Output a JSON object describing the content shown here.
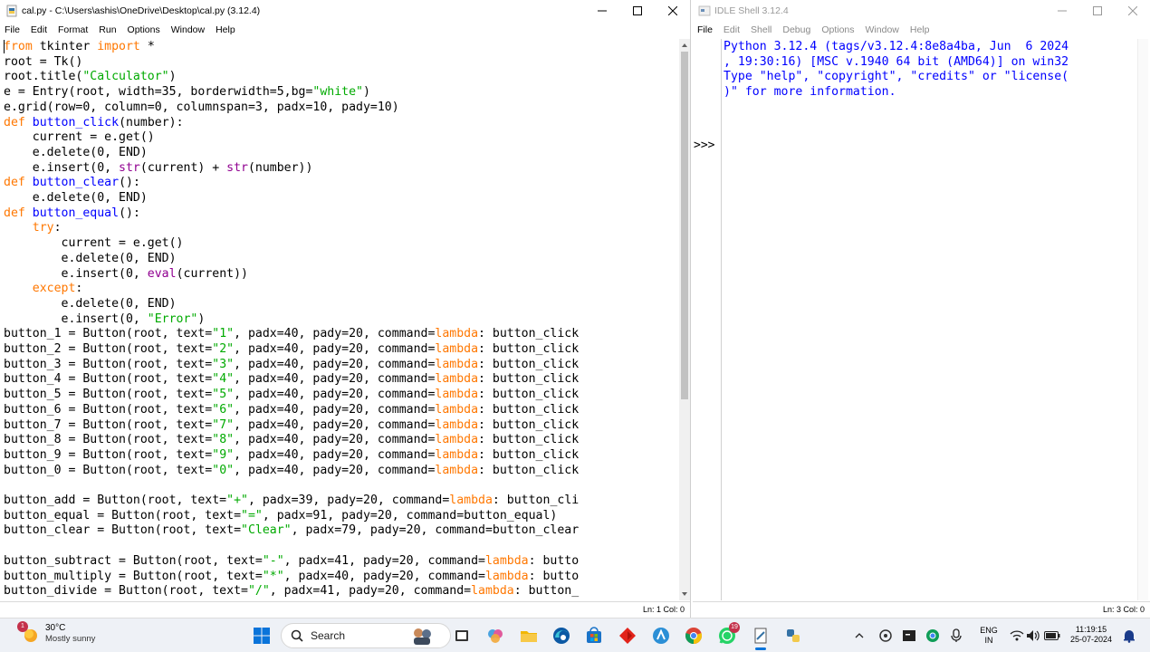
{
  "editor": {
    "title": "cal.py - C:\\Users\\ashis\\OneDrive\\Desktop\\cal.py (3.12.4)",
    "menu": [
      "File",
      "Edit",
      "Format",
      "Run",
      "Options",
      "Window",
      "Help"
    ],
    "status": "Ln: 1   Col: 0",
    "lines": [
      {
        "y": 0,
        "parts": [
          {
            "t": "from",
            "c": "kw"
          },
          {
            "t": " tkinter "
          },
          {
            "t": "import",
            "c": "kw"
          },
          {
            "t": " *"
          }
        ]
      },
      {
        "y": 1,
        "parts": [
          {
            "t": "root = Tk()"
          }
        ]
      },
      {
        "y": 2,
        "parts": [
          {
            "t": "root.title("
          },
          {
            "t": "\"Calculator\"",
            "c": "str"
          },
          {
            "t": ")"
          }
        ]
      },
      {
        "y": 3,
        "parts": [
          {
            "t": "e = Entry(root, width=35, borderwidth=5,bg="
          },
          {
            "t": "\"white\"",
            "c": "str"
          },
          {
            "t": ")"
          }
        ]
      },
      {
        "y": 4,
        "parts": [
          {
            "t": "e.grid(row=0, column=0, columnspan=3, padx=10, pady=10)"
          }
        ]
      },
      {
        "y": 5,
        "parts": [
          {
            "t": "def",
            "c": "kw"
          },
          {
            "t": " "
          },
          {
            "t": "button_click",
            "c": "def"
          },
          {
            "t": "(number):"
          }
        ]
      },
      {
        "y": 6,
        "parts": [
          {
            "t": "    current = e.get()"
          }
        ]
      },
      {
        "y": 7,
        "parts": [
          {
            "t": "    e.delete(0, END)"
          }
        ]
      },
      {
        "y": 8,
        "parts": [
          {
            "t": "    e.insert(0, "
          },
          {
            "t": "str",
            "c": "bi"
          },
          {
            "t": "(current) + "
          },
          {
            "t": "str",
            "c": "bi"
          },
          {
            "t": "(number))"
          }
        ]
      },
      {
        "y": 9,
        "parts": [
          {
            "t": "def",
            "c": "kw"
          },
          {
            "t": " "
          },
          {
            "t": "button_clear",
            "c": "def"
          },
          {
            "t": "():"
          }
        ]
      },
      {
        "y": 10,
        "parts": [
          {
            "t": "    e.delete(0, END)"
          }
        ]
      },
      {
        "y": 11,
        "parts": [
          {
            "t": "def",
            "c": "kw"
          },
          {
            "t": " "
          },
          {
            "t": "button_equal",
            "c": "def"
          },
          {
            "t": "():"
          }
        ]
      },
      {
        "y": 12,
        "parts": [
          {
            "t": "    "
          },
          {
            "t": "try",
            "c": "kw"
          },
          {
            "t": ":"
          }
        ]
      },
      {
        "y": 13,
        "parts": [
          {
            "t": "        current = e.get()"
          }
        ]
      },
      {
        "y": 14,
        "parts": [
          {
            "t": "        e.delete(0, END)"
          }
        ]
      },
      {
        "y": 15,
        "parts": [
          {
            "t": "        e.insert(0, "
          },
          {
            "t": "eval",
            "c": "bi"
          },
          {
            "t": "(current))"
          }
        ]
      },
      {
        "y": 16,
        "parts": [
          {
            "t": "    "
          },
          {
            "t": "except",
            "c": "kw"
          },
          {
            "t": ":"
          }
        ]
      },
      {
        "y": 17,
        "parts": [
          {
            "t": "        e.delete(0, END)"
          }
        ]
      },
      {
        "y": 18,
        "parts": [
          {
            "t": "        e.insert(0, "
          },
          {
            "t": "\"Error\"",
            "c": "str"
          },
          {
            "t": ")"
          }
        ]
      },
      {
        "y": 19,
        "parts": [
          {
            "t": "button_1 = Button(root, text="
          },
          {
            "t": "\"1\"",
            "c": "str"
          },
          {
            "t": ", padx=40, pady=20, command="
          },
          {
            "t": "lambda",
            "c": "kw"
          },
          {
            "t": ": button_click"
          }
        ]
      },
      {
        "y": 20,
        "parts": [
          {
            "t": "button_2 = Button(root, text="
          },
          {
            "t": "\"2\"",
            "c": "str"
          },
          {
            "t": ", padx=40, pady=20, command="
          },
          {
            "t": "lambda",
            "c": "kw"
          },
          {
            "t": ": button_click"
          }
        ]
      },
      {
        "y": 21,
        "parts": [
          {
            "t": "button_3 = Button(root, text="
          },
          {
            "t": "\"3\"",
            "c": "str"
          },
          {
            "t": ", padx=40, pady=20, command="
          },
          {
            "t": "lambda",
            "c": "kw"
          },
          {
            "t": ": button_click"
          }
        ]
      },
      {
        "y": 22,
        "parts": [
          {
            "t": "button_4 = Button(root, text="
          },
          {
            "t": "\"4\"",
            "c": "str"
          },
          {
            "t": ", padx=40, pady=20, command="
          },
          {
            "t": "lambda",
            "c": "kw"
          },
          {
            "t": ": button_click"
          }
        ]
      },
      {
        "y": 23,
        "parts": [
          {
            "t": "button_5 = Button(root, text="
          },
          {
            "t": "\"5\"",
            "c": "str"
          },
          {
            "t": ", padx=40, pady=20, command="
          },
          {
            "t": "lambda",
            "c": "kw"
          },
          {
            "t": ": button_click"
          }
        ]
      },
      {
        "y": 24,
        "parts": [
          {
            "t": "button_6 = Button(root, text="
          },
          {
            "t": "\"6\"",
            "c": "str"
          },
          {
            "t": ", padx=40, pady=20, command="
          },
          {
            "t": "lambda",
            "c": "kw"
          },
          {
            "t": ": button_click"
          }
        ]
      },
      {
        "y": 25,
        "parts": [
          {
            "t": "button_7 = Button(root, text="
          },
          {
            "t": "\"7\"",
            "c": "str"
          },
          {
            "t": ", padx=40, pady=20, command="
          },
          {
            "t": "lambda",
            "c": "kw"
          },
          {
            "t": ": button_click"
          }
        ]
      },
      {
        "y": 26,
        "parts": [
          {
            "t": "button_8 = Button(root, text="
          },
          {
            "t": "\"8\"",
            "c": "str"
          },
          {
            "t": ", padx=40, pady=20, command="
          },
          {
            "t": "lambda",
            "c": "kw"
          },
          {
            "t": ": button_click"
          }
        ]
      },
      {
        "y": 27,
        "parts": [
          {
            "t": "button_9 = Button(root, text="
          },
          {
            "t": "\"9\"",
            "c": "str"
          },
          {
            "t": ", padx=40, pady=20, command="
          },
          {
            "t": "lambda",
            "c": "kw"
          },
          {
            "t": ": button_click"
          }
        ]
      },
      {
        "y": 28,
        "parts": [
          {
            "t": "button_0 = Button(root, text="
          },
          {
            "t": "\"0\"",
            "c": "str"
          },
          {
            "t": ", padx=40, pady=20, command="
          },
          {
            "t": "lambda",
            "c": "kw"
          },
          {
            "t": ": button_click"
          }
        ]
      },
      {
        "y": 30,
        "parts": [
          {
            "t": "button_add = Button(root, text="
          },
          {
            "t": "\"+\"",
            "c": "str"
          },
          {
            "t": ", padx=39, pady=20, command="
          },
          {
            "t": "lambda",
            "c": "kw"
          },
          {
            "t": ": button_cli"
          }
        ]
      },
      {
        "y": 31,
        "parts": [
          {
            "t": "button_equal = Button(root, text="
          },
          {
            "t": "\"=\"",
            "c": "str"
          },
          {
            "t": ", padx=91, pady=20, command=button_equal)"
          }
        ]
      },
      {
        "y": 32,
        "parts": [
          {
            "t": "button_clear = Button(root, text="
          },
          {
            "t": "\"Clear\"",
            "c": "str"
          },
          {
            "t": ", padx=79, pady=20, command=button_clear"
          }
        ]
      },
      {
        "y": 34,
        "parts": [
          {
            "t": "button_subtract = Button(root, text="
          },
          {
            "t": "\"-\"",
            "c": "str"
          },
          {
            "t": ", padx=41, pady=20, command="
          },
          {
            "t": "lambda",
            "c": "kw"
          },
          {
            "t": ": butto"
          }
        ]
      },
      {
        "y": 35,
        "parts": [
          {
            "t": "button_multiply = Button(root, text="
          },
          {
            "t": "\"*\"",
            "c": "str"
          },
          {
            "t": ", padx=40, pady=20, command="
          },
          {
            "t": "lambda",
            "c": "kw"
          },
          {
            "t": ": butto"
          }
        ]
      },
      {
        "y": 36,
        "parts": [
          {
            "t": "button_divide = Button(root, text="
          },
          {
            "t": "\"/\"",
            "c": "str"
          },
          {
            "t": ", padx=41, pady=20, command="
          },
          {
            "t": "lambda",
            "c": "kw"
          },
          {
            "t": ": button_"
          }
        ]
      }
    ]
  },
  "shell": {
    "title": "IDLE Shell 3.12.4",
    "menu": [
      "File",
      "Edit",
      "Shell",
      "Debug",
      "Options",
      "Window",
      "Help"
    ],
    "prompt": ">>>",
    "lines": [
      "Python 3.12.4 (tags/v3.12.4:8e8a4ba, Jun  6 2024",
      ", 19:30:16) [MSC v.1940 64 bit (AMD64)] on win32",
      "Type \"help\", \"copyright\", \"credits\" or \"license(",
      ")\" for more information."
    ],
    "status": "Ln: 3   Col: 0"
  },
  "taskbar": {
    "weather_temp": "30°C",
    "weather_desc": "Mostly sunny",
    "weather_badge": "1",
    "search_label": "Search",
    "whatsapp_badge": "19",
    "lang_line1": "ENG",
    "lang_line2": "IN",
    "time": "11:19:15",
    "date": "25-07-2024"
  },
  "colors": {
    "keyword": "#ff7700",
    "builtin": "#900090",
    "string": "#00aa00",
    "definition": "#0000ff",
    "shell_output": "#0000ff"
  }
}
